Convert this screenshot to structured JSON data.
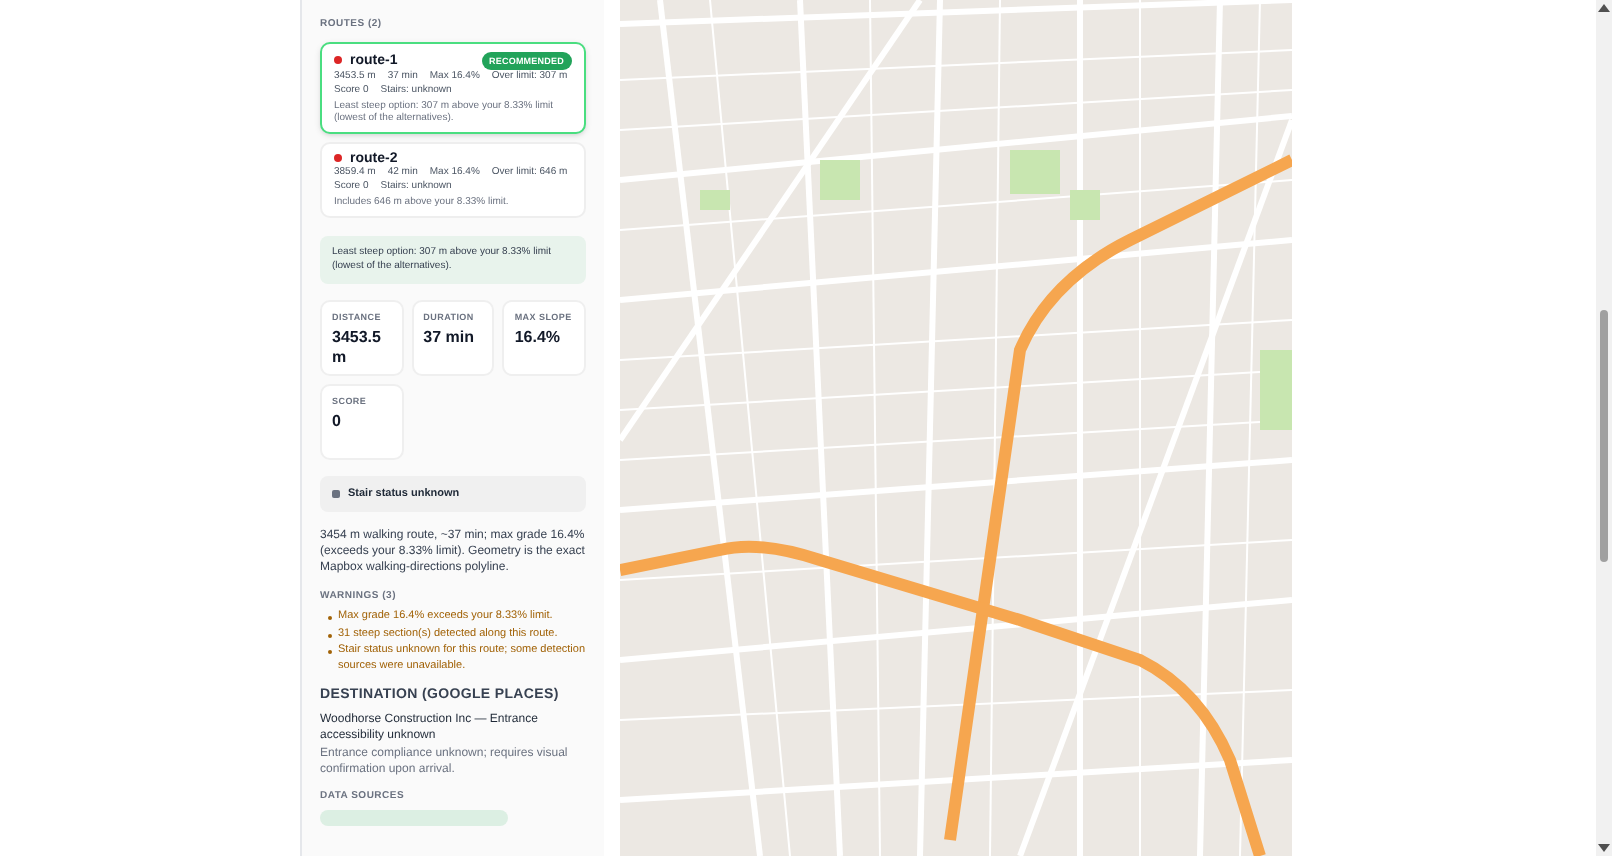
{
  "routes": {
    "title": "ROUTES (2)",
    "items": [
      {
        "name": "route-1",
        "color": "#dc2626",
        "selected": true,
        "badge": "RECOMMENDED",
        "stats": [
          "3453.5 m",
          "37 min",
          "Max 16.4%",
          "Over limit: 307 m"
        ],
        "stats_2": [
          "Score 0",
          "Stairs: unknown"
        ],
        "note": "Least steep option: 307 m above your 8.33% limit (lowest of the alternatives)."
      },
      {
        "name": "route-2",
        "color": "#dc2626",
        "selected": false,
        "stats": [
          "3859.4 m",
          "42 min",
          "Max 16.4%",
          "Over limit: 646 m"
        ],
        "stats_2": [
          "Score 0",
          "Stairs: unknown"
        ],
        "note": "Includes 646 m above your 8.33% limit."
      }
    ]
  },
  "notice": "Least steep option: 307 m above your 8.33% limit (lowest of the alternatives).",
  "metrics": [
    {
      "label": "DISTANCE",
      "value": "3453.5 m"
    },
    {
      "label": "DURATION",
      "value": "37 min"
    },
    {
      "label": "MAX SLOPE",
      "value": "16.4%"
    },
    {
      "label": "SCORE",
      "value": "0"
    }
  ],
  "stair_status": "Stair status unknown",
  "summary": "3454 m walking route, ~37 min; max grade 16.4% (exceeds your 8.33% limit). Geometry is the exact Mapbox walking-directions polyline.",
  "warnings": {
    "title": "WARNINGS (3)",
    "items": [
      "Max grade 16.4% exceeds your 8.33% limit.",
      "31 steep section(s) detected along this route.",
      "Stair status unknown for this route; some detection sources were unavailable."
    ]
  },
  "destination": {
    "title": "DESTINATION (GOOGLE PLACES)",
    "name": "Woodhorse Construction Inc — Entrance accessibility unknown",
    "detail": "Entrance compliance unknown; requires visual confirmation upon arrival."
  },
  "data_sources": {
    "title": "DATA SOURCES"
  }
}
